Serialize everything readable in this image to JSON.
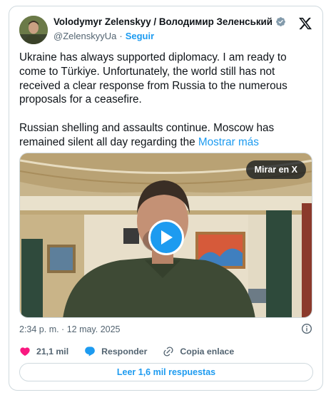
{
  "author": {
    "display_name": "Volodymyr Zelenskyy / Володимир Зеленський",
    "handle": "@ZelenskyyUa",
    "separator": "·",
    "follow_label": "Seguir",
    "verified_color": "#829aab"
  },
  "post": {
    "paragraphs": [
      "Ukraine has always supported diplomacy. I am ready to come to Türkiye. Unfortunately, the world still has not received a clear response from Russia to the numerous proposals for a ceasefire.",
      "Russian shelling and assaults continue. Moscow has remained silent all day regarding the"
    ],
    "show_more_label": "Mostrar más"
  },
  "media": {
    "watch_label": "Mirar en X",
    "play_icon": "play-icon"
  },
  "meta": {
    "timestamp": "2:34 p. m. · 12 may. 2025"
  },
  "actions": {
    "like_count": "21,1 mil",
    "reply_label": "Responder",
    "copy_label": "Copia enlace"
  },
  "footer": {
    "replies_label": "Leer 1,6 mil respuestas"
  },
  "colors": {
    "accent": "#1d9bf0",
    "like": "#f91880",
    "muted": "#536471",
    "border": "#cfd9de"
  }
}
